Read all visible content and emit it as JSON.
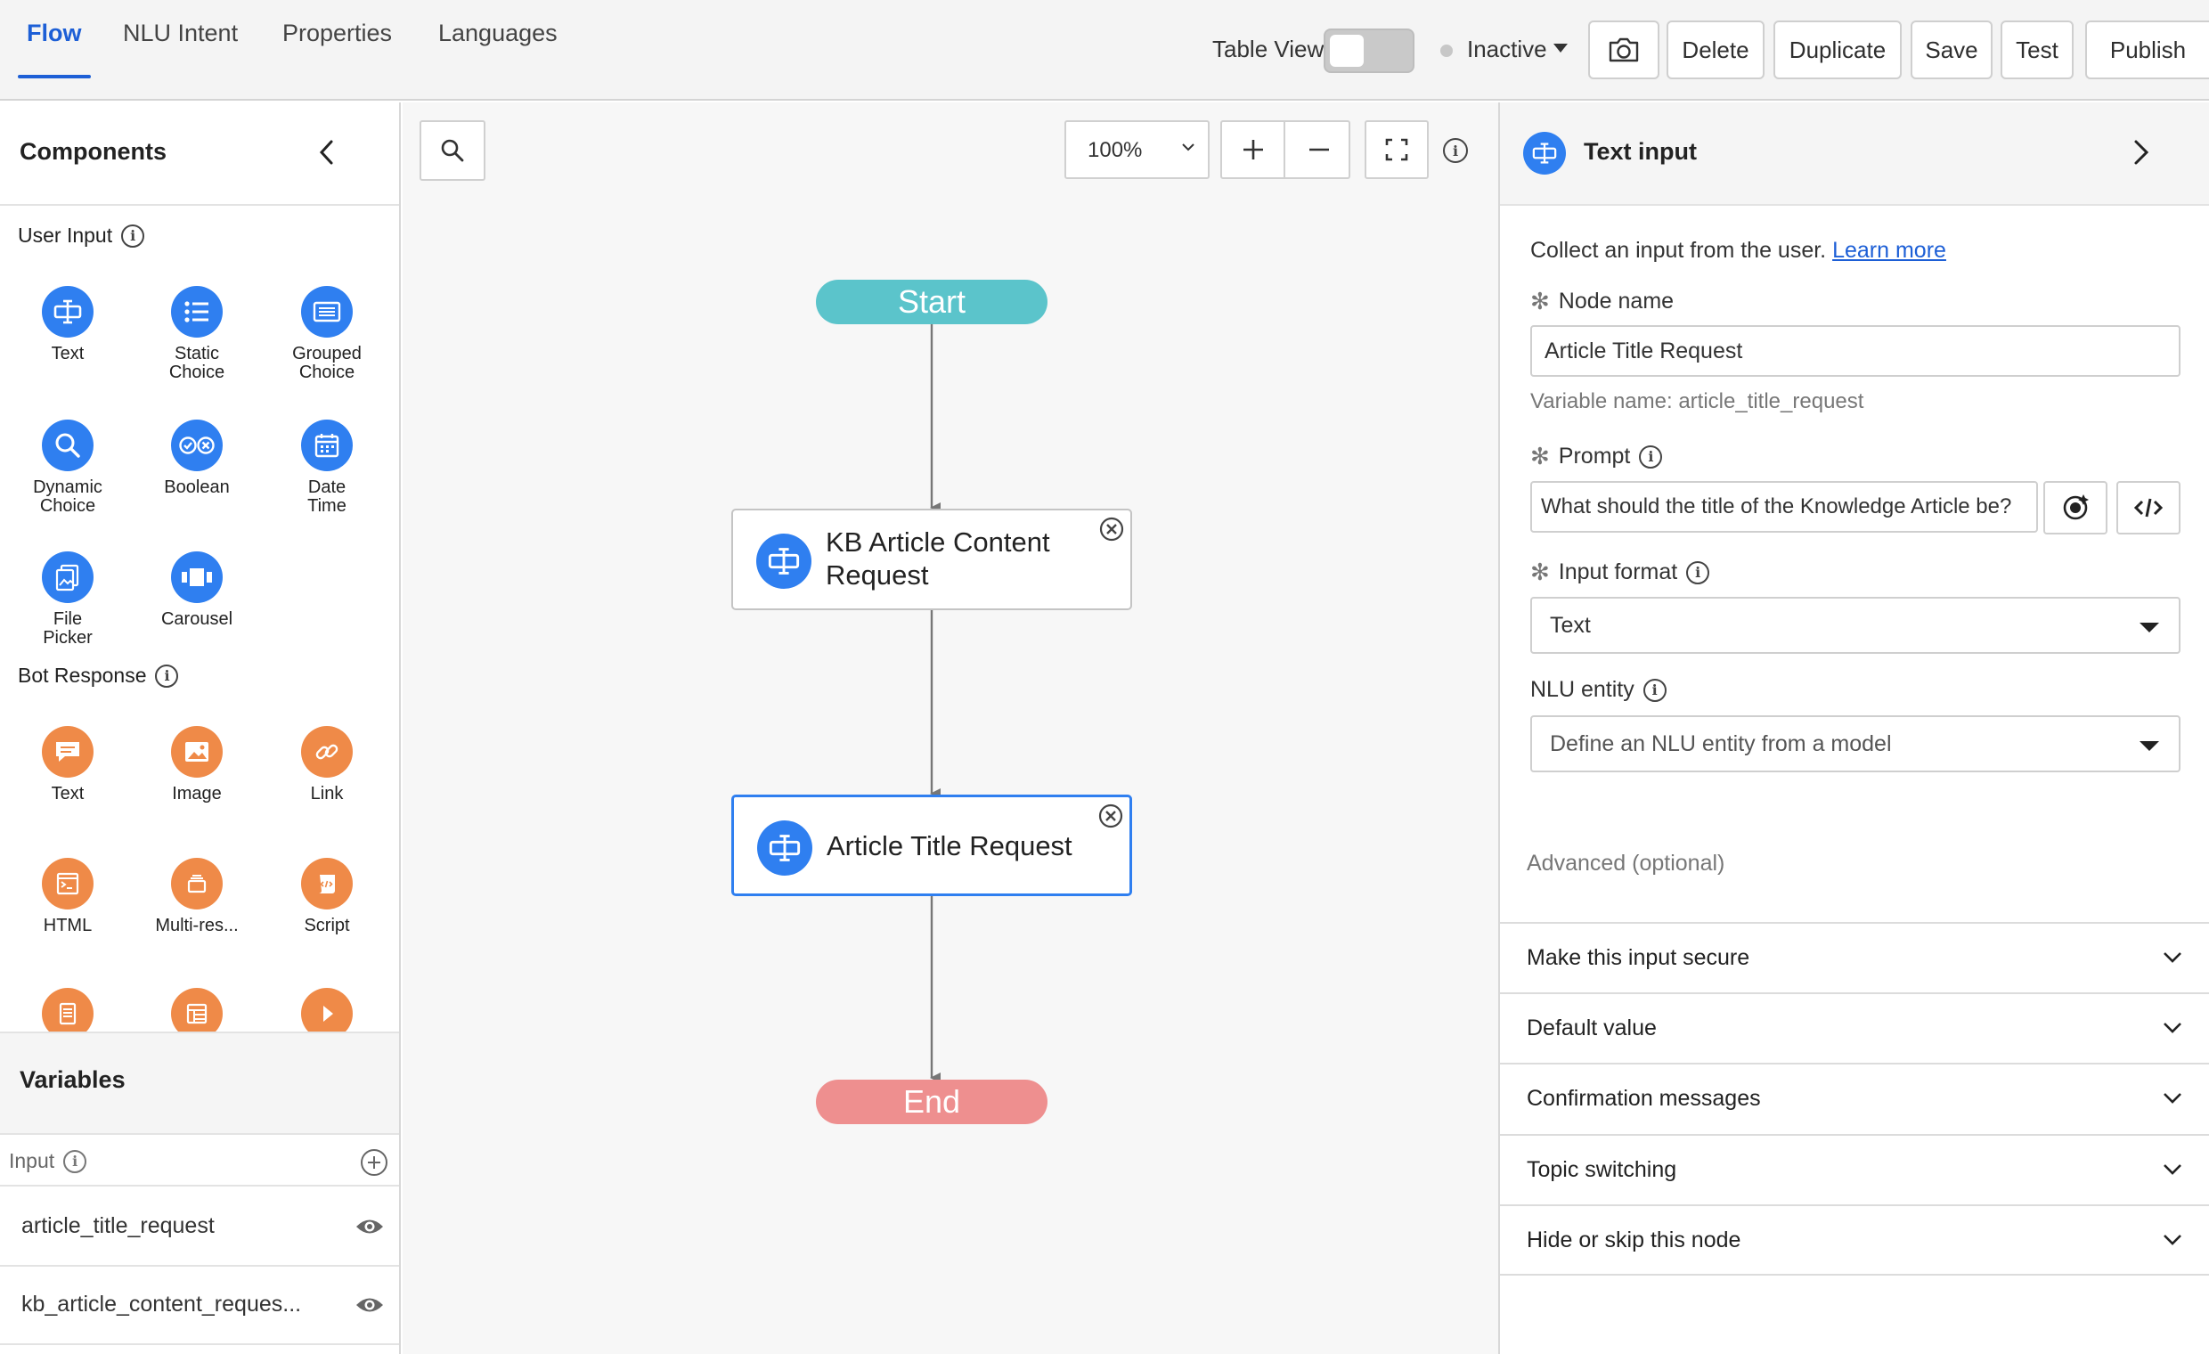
{
  "tabs": [
    {
      "label": "Flow",
      "active": true
    },
    {
      "label": "NLU Intent"
    },
    {
      "label": "Properties"
    },
    {
      "label": "Languages"
    }
  ],
  "toolbar": {
    "table_view_label": "Table View",
    "table_view_on": false,
    "status_label": "Inactive",
    "camera_icon": "camera-icon",
    "delete_label": "Delete",
    "duplicate_label": "Duplicate",
    "save_label": "Save",
    "test_label": "Test",
    "publish_label": "Publish"
  },
  "components_panel": {
    "title": "Components",
    "user_input_label": "User Input",
    "user_input_items": [
      {
        "label": "Text",
        "icon": "text-input-icon"
      },
      {
        "label": "Static Choice",
        "icon": "list-icon"
      },
      {
        "label": "Grouped Choice",
        "icon": "grouped-choice-icon"
      },
      {
        "label": "Dynamic Choice",
        "icon": "search-icon"
      },
      {
        "label": "Boolean",
        "icon": "boolean-icon"
      },
      {
        "label": "Date Time",
        "icon": "calendar-icon"
      },
      {
        "label": "File Picker",
        "icon": "file-picker-icon"
      },
      {
        "label": "Carousel",
        "icon": "carousel-icon"
      }
    ],
    "bot_response_label": "Bot Response",
    "bot_response_items": [
      {
        "label": "Text",
        "icon": "chat-bubble-icon"
      },
      {
        "label": "Image",
        "icon": "image-icon"
      },
      {
        "label": "Link",
        "icon": "link-icon"
      },
      {
        "label": "HTML",
        "icon": "html-icon"
      },
      {
        "label": "Multi-res...",
        "icon": "multi-response-icon"
      },
      {
        "label": "Script",
        "icon": "script-icon"
      }
    ]
  },
  "variables_panel": {
    "title": "Variables",
    "input_label": "Input",
    "items": [
      {
        "name": "article_title_request"
      },
      {
        "name": "kb_article_content_reques..."
      }
    ]
  },
  "canvas": {
    "zoom": "100%",
    "start_label": "Start",
    "end_label": "End",
    "nodes": [
      {
        "title": "KB Article Content Request",
        "line1": "KB Article Content",
        "line2": "Request",
        "selected": false
      },
      {
        "title": "Article Title Request",
        "selected": true
      }
    ]
  },
  "properties_panel": {
    "title": "Text input",
    "description": "Collect an input from the user.",
    "learn_more": "Learn more",
    "node_name_label": "Node name",
    "node_name_value": "Article Title Request",
    "variable_name_hint": "Variable name: article_title_request",
    "prompt_label": "Prompt",
    "prompt_value": "What should the title of the Knowledge Article be?",
    "input_format_label": "Input format",
    "input_format_value": "Text",
    "nlu_entity_label": "NLU entity",
    "nlu_entity_placeholder": "Define an NLU entity from a model",
    "advanced_label": "Advanced (optional)",
    "accordions": [
      "Make this input secure",
      "Default value",
      "Confirmation messages",
      "Topic switching",
      "Hide or skip this node"
    ]
  },
  "colors": {
    "accent": "#1d5fd6",
    "input_blue": "#2f7ff0",
    "response_orange": "#ef8a48",
    "start": "#5bc4cb",
    "end": "#ee8f8f"
  }
}
